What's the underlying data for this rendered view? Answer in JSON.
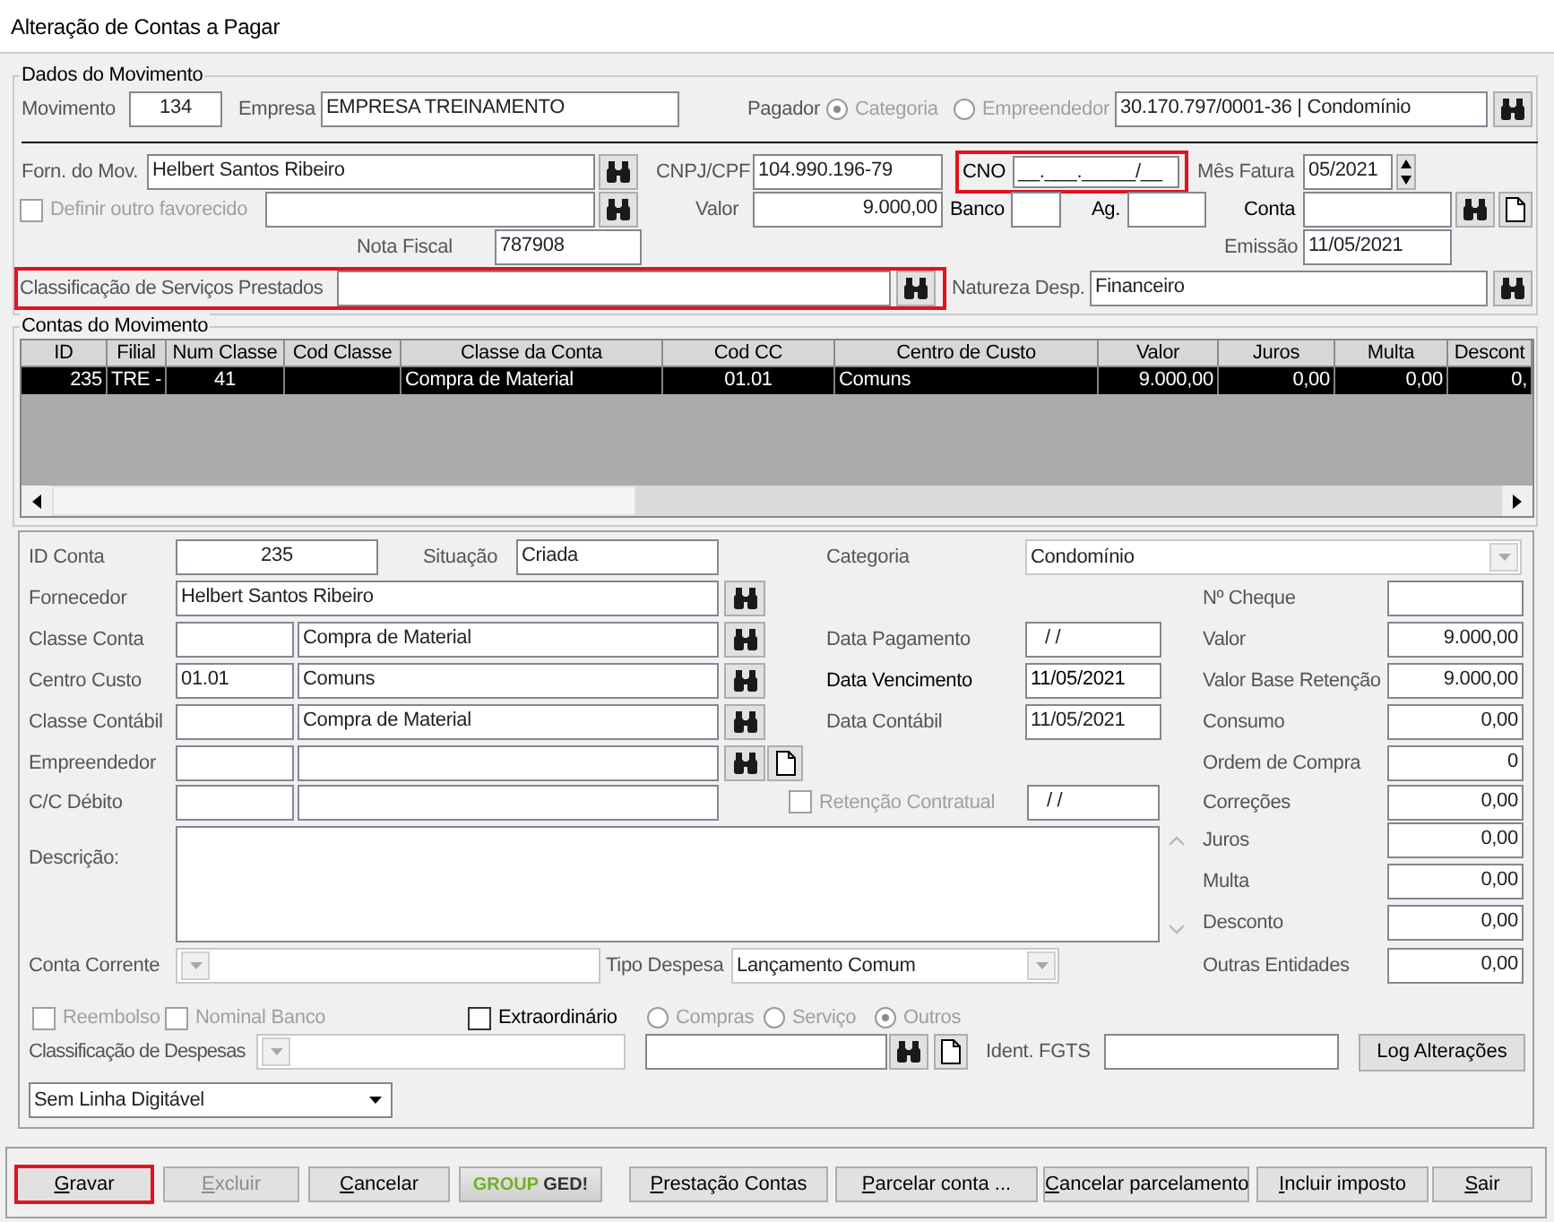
{
  "window": {
    "title": "Alteração de Contas a Pagar"
  },
  "dados": {
    "title": "Dados do Movimento",
    "movimento": {
      "label": "Movimento",
      "value": "134"
    },
    "empresa": {
      "label": "Empresa",
      "value": "EMPRESA TREINAMENTO"
    },
    "pagador": {
      "label": "Pagador",
      "value": "30.170.797/0001-36 | Condomínio",
      "options": [
        {
          "label": "Categoria",
          "selected": true,
          "disabled": true
        },
        {
          "label": "Empreendedor",
          "selected": false,
          "disabled": true
        }
      ]
    },
    "fornecedor": {
      "label": "Forn. do Mov.",
      "value": "Helbert Santos Ribeiro"
    },
    "cnpj": {
      "label": "CNPJ/CPF",
      "value": "104.990.196-79"
    },
    "cno": {
      "label": "CNO",
      "value": "__.___._____/__",
      "highlighted": true
    },
    "mes_fatura": {
      "label": "Mês Fatura",
      "value": "05/2021"
    },
    "outro_favorecido": {
      "label": "Definir outro favorecido",
      "checked": false,
      "disabled": true
    },
    "valor": {
      "label": "Valor",
      "value": "9.000,00"
    },
    "banco": {
      "label": "Banco",
      "emphasized": true
    },
    "agencia": {
      "label": "Ag.",
      "emphasized": true
    },
    "conta": {
      "label": "Conta",
      "emphasized": true
    },
    "nota_fiscal": {
      "label": "Nota Fiscal",
      "value": "787908"
    },
    "emissao": {
      "label": "Emissão",
      "value": "11/05/2021"
    },
    "classificacao_servicos": {
      "label": "Classificação de Serviços Prestados",
      "highlighted": true
    },
    "natureza": {
      "label": "Natureza Desp.",
      "value": "Financeiro"
    }
  },
  "contas": {
    "title": "Contas do Movimento",
    "columns": [
      "ID",
      "Filial",
      "Num Classe",
      "Cod Classe",
      "Classe da Conta",
      "Cod CC",
      "Centro de Custo",
      "Valor",
      "Juros",
      "Multa",
      "Descont"
    ],
    "rows": [
      {
        "selected": true,
        "cells": [
          "235",
          "TRE -",
          "41",
          null,
          "Compra de Material",
          "01.01",
          "Comuns",
          "9.000,00",
          "0,00",
          "0,00",
          "0,"
        ]
      }
    ]
  },
  "conta": {
    "id_conta": {
      "label": "ID Conta",
      "value": "235"
    },
    "situacao": {
      "label": "Situação",
      "value": "Criada"
    },
    "categoria": {
      "label": "Categoria",
      "value": "Condomínio",
      "disabled": true
    },
    "fornecedor": {
      "label": "Fornecedor",
      "value": "Helbert Santos Ribeiro"
    },
    "classe_conta": {
      "label": "Classe Conta",
      "name": "Compra de Material"
    },
    "centro_custo": {
      "label": "Centro Custo",
      "code": "01.01",
      "name": "Comuns"
    },
    "classe_contabil": {
      "label": "Classe Contábil",
      "name": "Compra de Material"
    },
    "empreendedor": {
      "label": "Empreendedor"
    },
    "cc_debito": {
      "label": "C/C Débito"
    },
    "retencao": {
      "label": "Retenção Contratual",
      "checked": false,
      "disabled": true,
      "date": "/ /"
    },
    "data_pagamento": {
      "label": "Data Pagamento",
      "value": "/ /"
    },
    "data_vencimento": {
      "label": "Data Vencimento",
      "value": "11/05/2021",
      "emphasized": true
    },
    "data_contabil": {
      "label": "Data Contábil",
      "value": "11/05/2021"
    },
    "descricao": {
      "label": "Descrição:"
    },
    "conta_corrente": {
      "label": "Conta Corrente",
      "disabled": true
    },
    "tipo_despesa": {
      "label": "Tipo Despesa",
      "value": "Lançamento Comum",
      "disabled": true
    },
    "opcoes": [
      {
        "label": "Reembolso",
        "checked": false,
        "disabled": true
      },
      {
        "label": "Nominal Banco",
        "checked": false,
        "disabled": true
      },
      {
        "label": "Extraordinário",
        "checked": false,
        "disabled": false
      }
    ],
    "tipo_compra": [
      {
        "label": "Compras",
        "selected": false,
        "disabled": true
      },
      {
        "label": "Serviço",
        "selected": false,
        "disabled": true
      },
      {
        "label": "Outros",
        "selected": true,
        "disabled": true
      }
    ],
    "classificacao_despesas": {
      "label": "Classificação de Despesas",
      "disabled": true
    },
    "ident_fgts": {
      "label": "Ident. FGTS"
    },
    "log_button": "Log Alterações",
    "linha_digitavel": {
      "value": "Sem Linha Digitável",
      "disabled": false
    },
    "valores": [
      {
        "label": "Nº Cheque"
      },
      {
        "label": "Valor",
        "value": "9.000,00"
      },
      {
        "label": "Valor Base Retenção",
        "value": "9.000,00"
      },
      {
        "label": "Consumo",
        "value": "0,00"
      },
      {
        "label": "Ordem de Compra",
        "value": "0"
      },
      {
        "label": "Correções",
        "value": "0,00"
      },
      {
        "label": "Juros",
        "value": "0,00"
      },
      {
        "label": "Multa",
        "value": "0,00"
      },
      {
        "label": "Desconto",
        "value": "0,00"
      },
      {
        "label": "Outras Entidades",
        "value": "0,00"
      }
    ]
  },
  "buttons": [
    {
      "kind": "text",
      "label": "Gravar",
      "disabled": false,
      "highlighted": true
    },
    {
      "kind": "text",
      "label": "Excluir",
      "disabled": true,
      "highlighted": false
    },
    {
      "kind": "text",
      "label": "Cancelar",
      "disabled": false,
      "highlighted": false
    },
    {
      "kind": "logo",
      "first": "GROUP",
      "second": "GED!"
    },
    {
      "kind": "text",
      "label": "Prestação Contas",
      "disabled": false,
      "highlighted": false
    },
    {
      "kind": "text",
      "label": "Parcelar conta ...",
      "disabled": false,
      "highlighted": false
    },
    {
      "kind": "text",
      "label": "Cancelar parcelamento",
      "disabled": false,
      "highlighted": false
    },
    {
      "kind": "text",
      "label": "Incluir imposto",
      "disabled": false,
      "highlighted": false
    },
    {
      "kind": "text",
      "label": "Sair",
      "disabled": false,
      "highlighted": false
    }
  ]
}
